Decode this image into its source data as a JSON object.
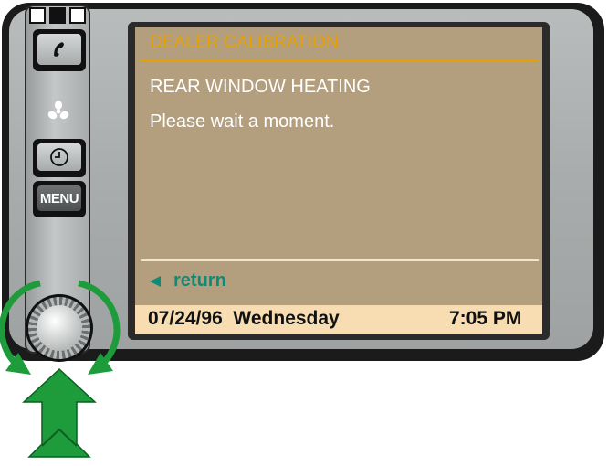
{
  "screen": {
    "title": "DEALER CALIBRATION",
    "heading": "REAR WINDOW HEATING",
    "message": "Please wait a moment.",
    "return_label": "return",
    "status": {
      "date": "07/24/96  Wednesday",
      "time": "7:05 PM"
    }
  },
  "controls": {
    "menu_label": "MENU",
    "icons": [
      "phone-icon",
      "fan-icon",
      "clock-icon"
    ]
  },
  "colors": {
    "screen_background": "#b39f7e",
    "title": "#e8a000",
    "return": "#0f8a78",
    "status_bar": "#f7ddb1",
    "arrows": "#1e9b3a"
  }
}
